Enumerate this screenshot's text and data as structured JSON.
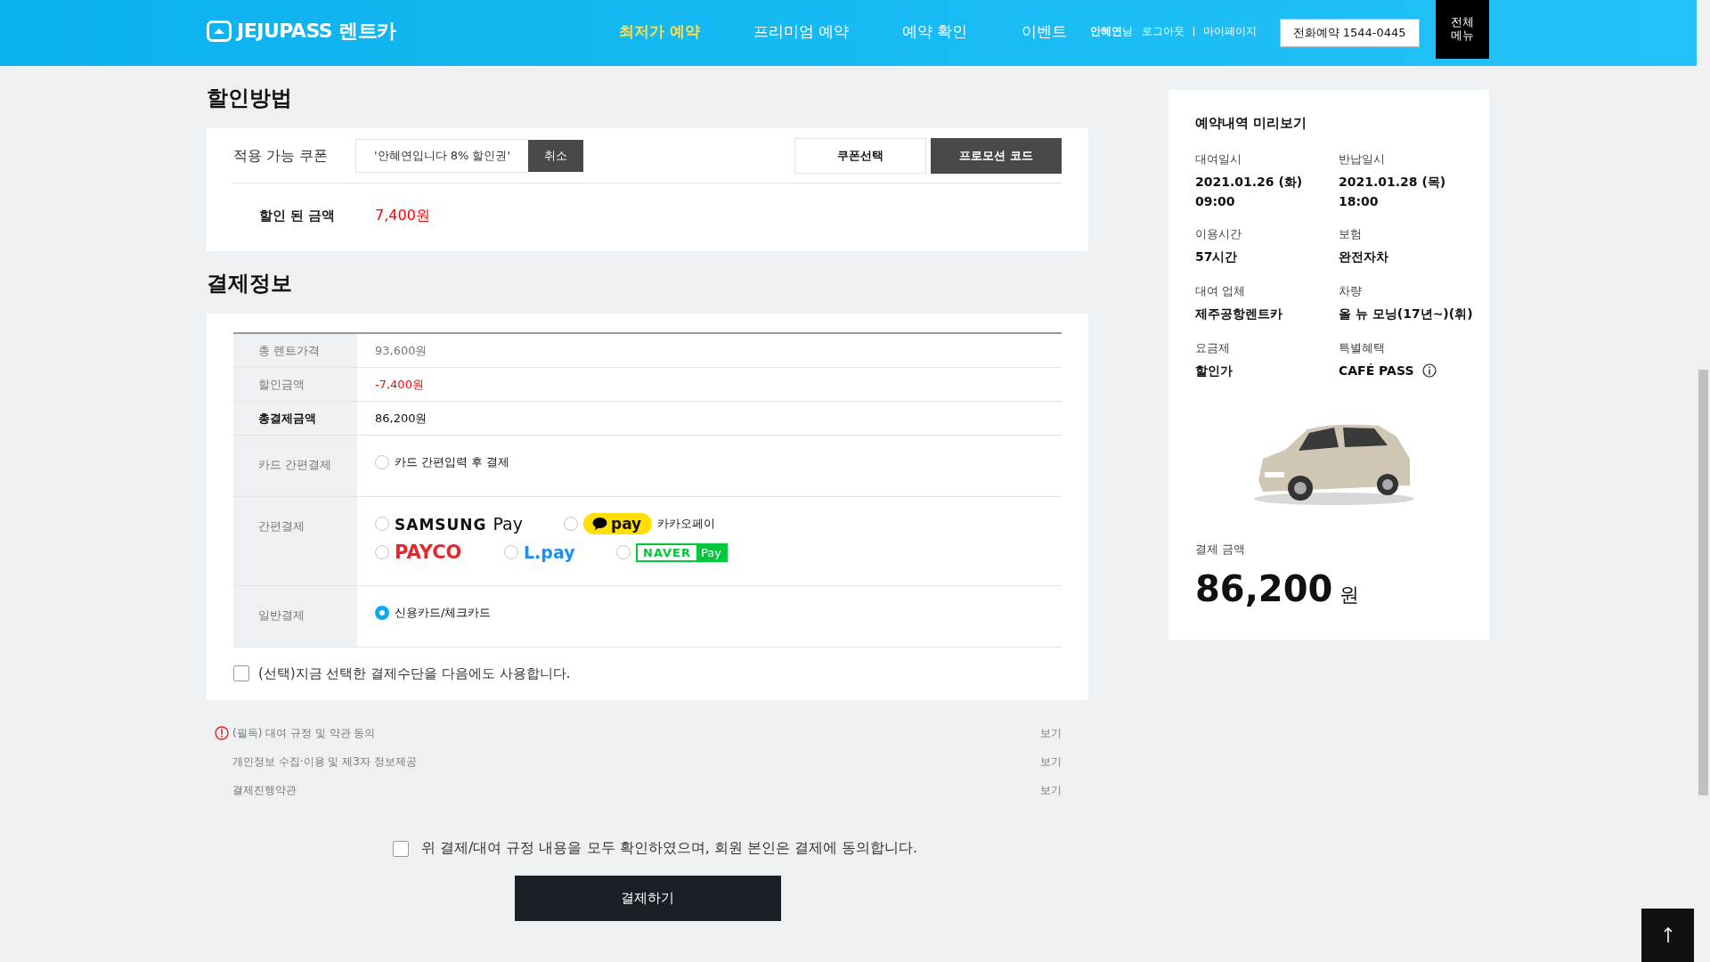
{
  "header": {
    "logo": "JEJUPASS 렌트카",
    "nav": [
      {
        "label": "최저가 예약",
        "selected": true
      },
      {
        "label": "프리미엄 예약",
        "selected": false
      },
      {
        "label": "예약 확인",
        "selected": false
      },
      {
        "label": "이벤트",
        "selected": false
      }
    ],
    "user": "**안혜연**님",
    "links": [
      "로그아웃",
      "마이페이지"
    ],
    "phone_button": "전화예약 1544-0445",
    "menu_button": "전체 메뉴"
  },
  "discount": {
    "title": "할인방법",
    "coupon_label": "적용 가능 쿠폰",
    "coupon_value": "'안혜연입니다 8% 할인권'",
    "cancel_button": "취소",
    "coupon_select_button": "쿠폰선택",
    "promo_button": "프로모션 코드",
    "discounted_label": "할인 된 금액",
    "discounted_value": "7,400원"
  },
  "payment": {
    "title": "결제정보",
    "summary": [
      {
        "label": "총 렌트가격",
        "value": "93,600원",
        "kind": "normal"
      },
      {
        "label": "할인금액",
        "value": "-7,400원",
        "kind": "discount"
      },
      {
        "label": "총결제금액",
        "value": "86,200원",
        "kind": "total"
      }
    ],
    "methods": [
      {
        "label": "카드 간편결제",
        "options": [
          {
            "kind": "text",
            "label": "카드 간편입력 후 결제",
            "selected": false
          }
        ]
      },
      {
        "label": "간편결제",
        "options": [
          {
            "kind": "samsung",
            "logo": "SAMSUNG",
            "logo_suffix": "Pay",
            "selected": false
          },
          {
            "kind": "kakao",
            "logo": "pay",
            "label": "카카오페이",
            "selected": false
          },
          {
            "kind": "payco",
            "logo": "PAYCO",
            "selected": false
          },
          {
            "kind": "lpay",
            "logo": "L.pay",
            "selected": false
          },
          {
            "kind": "naver",
            "logo": "NAVER",
            "logo_suffix": "Pay",
            "selected": false
          }
        ]
      },
      {
        "label": "일반결제",
        "options": [
          {
            "kind": "text",
            "label": "신용카드/체크카드",
            "selected": true
          }
        ]
      }
    ],
    "remember": {
      "label": "(선택)지금 선택한 결제수단을 다음에도 사용합니다.",
      "checked": false
    }
  },
  "terms": [
    {
      "label": "(필독) 대여 규정 및 약관 동의",
      "required": true,
      "link": "보기"
    },
    {
      "label": "개인정보 수집·이용 및 제3자 정보제공",
      "required": false,
      "link": "보기"
    },
    {
      "label": "결제진행약관",
      "required": false,
      "link": "보기"
    }
  ],
  "agree": {
    "label": "위 결제/대여 규정 내용을 모두 확인하였으며, 회원 본인은 결제에 동의합니다.",
    "checked": false
  },
  "pay_button": "결제하기",
  "preview": {
    "title": "예약내역 미리보기",
    "fields": [
      {
        "label": "대여일시",
        "lines": [
          "2021.01.26 (화)",
          "09:00"
        ],
        "info": false
      },
      {
        "label": "반납일시",
        "lines": [
          "2021.01.28 (목)",
          "18:00"
        ],
        "info": false
      },
      {
        "label": "이용시간",
        "lines": [
          "57시간"
        ],
        "info": false
      },
      {
        "label": "보험",
        "lines": [
          "완전자차"
        ],
        "info": false
      },
      {
        "label": "대여 업체",
        "lines": [
          "제주공항렌트카"
        ],
        "info": false
      },
      {
        "label": "차량",
        "lines": [
          "올 뉴 모닝(17년~)(휘)"
        ],
        "info": false
      },
      {
        "label": "요금제",
        "lines": [
          "할인가"
        ],
        "info": false
      },
      {
        "label": "특별혜택",
        "lines": [
          "CAFÉ PASS"
        ],
        "info": true
      }
    ],
    "amount_label": "결제 금액",
    "amount": "86,200",
    "currency": "원"
  }
}
